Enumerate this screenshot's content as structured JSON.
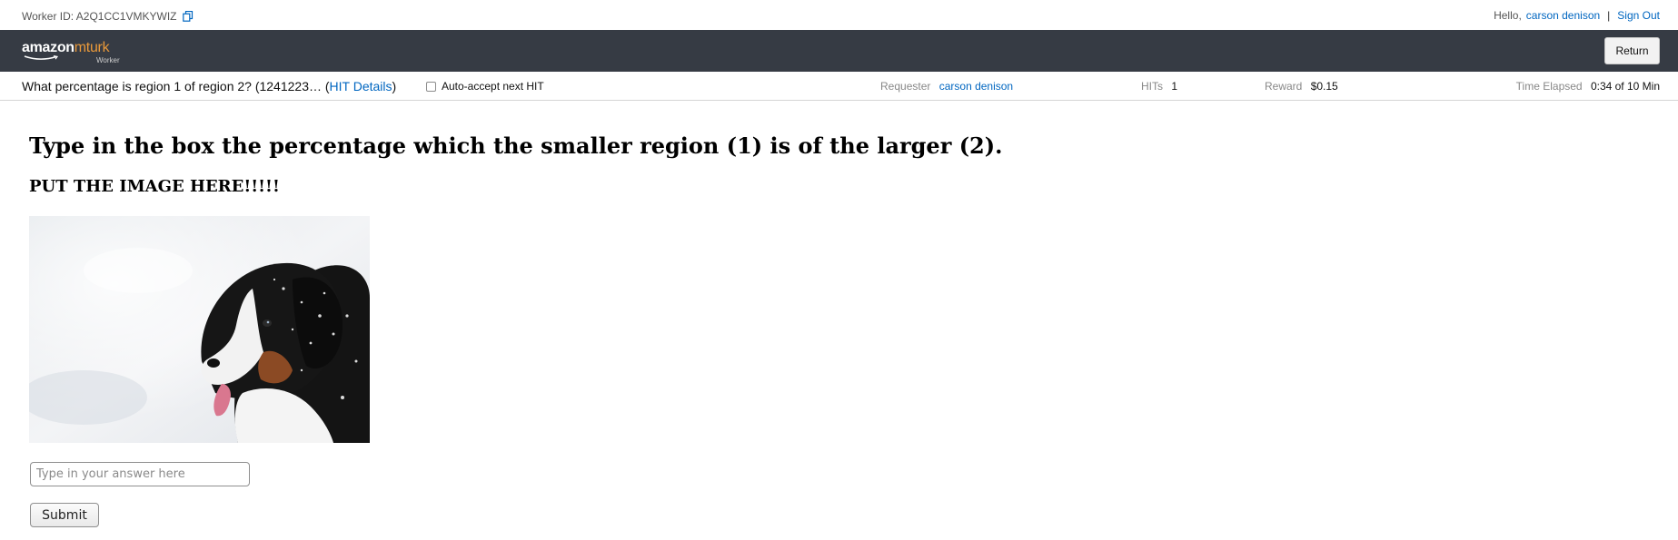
{
  "topbar": {
    "worker_id_label": "Worker ID: A2Q1CC1VMKYWIZ",
    "greeting": "Hello,",
    "username": "carson denison",
    "separator": "|",
    "sign_out": "Sign Out"
  },
  "navbar": {
    "logo_amazon": "amazon",
    "logo_mturk": "mturk",
    "logo_sub": "Worker",
    "return_label": "Return"
  },
  "hitbar": {
    "title": "What percentage is region 1 of region 2? (1241223… (",
    "details_link": "HIT Details",
    "title_close": ")",
    "auto_accept_label": "Auto-accept next HIT",
    "requester_label": "Requester",
    "requester_value": "carson denison",
    "hits_label": "HITs",
    "hits_value": "1",
    "reward_label": "Reward",
    "reward_value": "$0.15",
    "time_label": "Time Elapsed",
    "time_value": "0:34 of 10 Min"
  },
  "task": {
    "heading": "Type in the box the percentage which the smaller region (1) is of the larger (2).",
    "subheading": "PUT THE IMAGE HERE!!!!!",
    "image_icon": "puppy-in-snow-photo",
    "answer_placeholder": "Type in your answer here",
    "answer_value": "",
    "submit_label": "Submit"
  },
  "colors": {
    "nav_bg": "#363b44",
    "link": "#0066c0",
    "mturk_orange": "#e9993a"
  }
}
